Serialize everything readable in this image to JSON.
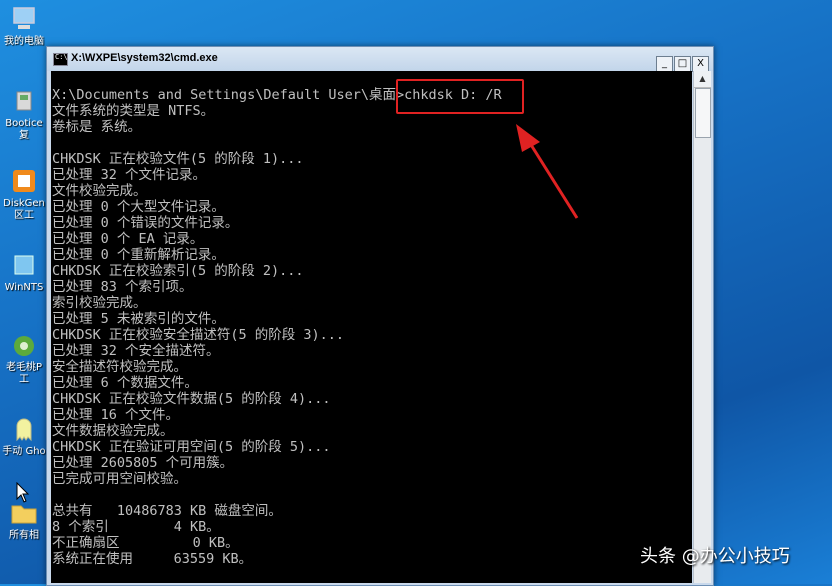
{
  "desktop_icons": [
    {
      "label": "我的电脑",
      "icon": "computer-icon"
    },
    {
      "label": "Bootice 复",
      "icon": "bootice-icon"
    },
    {
      "label": "DiskGen 区工",
      "icon": "diskgenius-icon"
    },
    {
      "label": "WinNTS",
      "icon": "winntsetup-icon"
    },
    {
      "label": "老毛桃P 工",
      "icon": "laomaotao-icon"
    },
    {
      "label": "手动 Gho",
      "icon": "ghost-icon"
    },
    {
      "label": "所有相",
      "icon": "folder-icon"
    }
  ],
  "window": {
    "title": "X:\\WXPE\\system32\\cmd.exe",
    "minimize": "_",
    "maximize": "□",
    "close": "X"
  },
  "console_lines": [
    "",
    "X:\\Documents and Settings\\Default User\\桌面>chkdsk D: /R",
    "文件系统的类型是 NTFS。",
    "卷标是 系统。",
    "",
    "CHKDSK 正在校验文件(5 的阶段 1)...",
    "已处理 32 个文件记录。",
    "文件校验完成。",
    "已处理 0 个大型文件记录。",
    "已处理 0 个错误的文件记录。",
    "已处理 0 个 EA 记录。",
    "已处理 0 个重新解析记录。",
    "CHKDSK 正在校验索引(5 的阶段 2)...",
    "已处理 83 个索引项。",
    "索引校验完成。",
    "已处理 5 未被索引的文件。",
    "CHKDSK 正在校验安全描述符(5 的阶段 3)...",
    "已处理 32 个安全描述符。",
    "安全描述符校验完成。",
    "已处理 6 个数据文件。",
    "CHKDSK 正在校验文件数据(5 的阶段 4)...",
    "已处理 16 个文件。",
    "文件数据校验完成。",
    "CHKDSK 正在验证可用空间(5 的阶段 5)...",
    "已处理 2605805 个可用簇。",
    "已完成可用空间校验。",
    "",
    "总共有   10486783 KB 磁盘空间。",
    "8 个索引        4 KB。",
    "不正确扇区         0 KB。",
    "系统正在使用     63559 KB。"
  ],
  "watermark": "头条 @办公小技巧",
  "colors": {
    "highlight": "#e02222",
    "console_bg": "#000000",
    "console_text": "#c0c0c0"
  }
}
